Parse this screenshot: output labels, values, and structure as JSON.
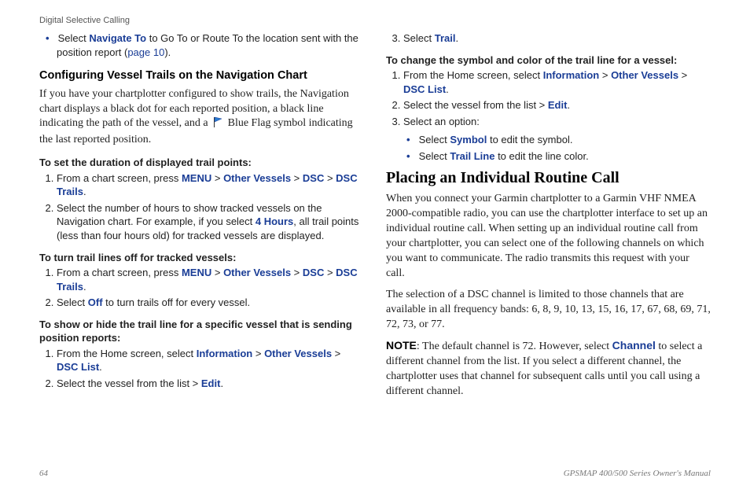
{
  "header": {
    "section": "Digital Selective Calling"
  },
  "left": {
    "bullet_prefix": "Select ",
    "navigate_to": "Navigate To",
    "bullet_mid": " to Go To or Route To the location sent with the position report (",
    "page_ref": "page 10",
    "bullet_end": ").",
    "h3": "Configuring Vessel Trails on the Navigation Chart",
    "intro_a": "If you have your chartplotter configured to show trails, the Navigation chart displays a black dot for each reported position, a black line indicating the path of the vessel, and a ",
    "intro_b": " Blue Flag symbol indicating the last reported position.",
    "task1_title": "To set the duration of displayed trail points:",
    "task1_step1_a": "From a chart screen, press ",
    "menu": "MENU",
    "gt": " > ",
    "other_vessels": "Other Vessels",
    "dsc": "DSC",
    "dsc_trails": "DSC Trails",
    "task1_step1_end": ".",
    "task1_step2_a": "Select the number of hours to show tracked vessels on the Navigation chart. For example, if you select ",
    "four_hours": "4 Hours",
    "task1_step2_b": ", all trail points (less than four hours old) for tracked vessels are displayed.",
    "task2_title": "To turn trail lines off for tracked vessels:",
    "task2_step1_a": "From a chart screen, press ",
    "task2_step2_a": "Select ",
    "off": "Off",
    "task2_step2_b": " to turn trails off for every vessel.",
    "task3_title": "To show or hide the trail line for a specific vessel that is sending position reports:",
    "task3_step1_a": "From the Home screen, select ",
    "information": "Information",
    "dsc_list": "DSC List",
    "task3_step2_a": "Select the vessel from the list > ",
    "edit": "Edit",
    "period": "."
  },
  "right": {
    "step3_a": "Select ",
    "trail": "Trail",
    "period": ".",
    "task4_title": "To change the symbol and color of the trail line for a vessel:",
    "task4_step1_a": "From the Home screen, select ",
    "information": "Information",
    "gt": " > ",
    "other_vessels": "Other Vessels",
    "dsc_list": "DSC List",
    "task4_step2_a": "Select the vessel from the list > ",
    "edit": "Edit",
    "task4_step3": "Select an option:",
    "bullet1_a": "Select ",
    "symbol": "Symbol",
    "bullet1_b": " to edit the symbol.",
    "bullet2_a": "Select ",
    "trail_line": "Trail Line",
    "bullet2_b": " to edit the line color.",
    "h2": "Placing an Individual Routine Call",
    "p1": "When you connect your Garmin chartplotter to a Garmin VHF NMEA 2000-compatible radio, you can use the chartplotter interface to set up an individual routine call. When setting up an individual routine call from your chartplotter, you can select one of the following channels on which you want to communicate. The radio transmits this request with your call.",
    "p2": "The selection of a DSC channel is limited to those channels that are available in all frequency bands: 6, 8, 9, 10, 13, 15, 16, 17, 67, 68, 69, 71, 72, 73, or 77.",
    "note_label": "NOTE",
    "p3_a": ": The default channel is 72. However, select ",
    "channel": "Channel",
    "p3_b": " to select a different channel from the list. If you select a different channel, the chartplotter uses that channel for subsequent calls until you call using a different channel."
  },
  "footer": {
    "page": "64",
    "manual": "GPSMAP 400/500 Series Owner's Manual"
  }
}
